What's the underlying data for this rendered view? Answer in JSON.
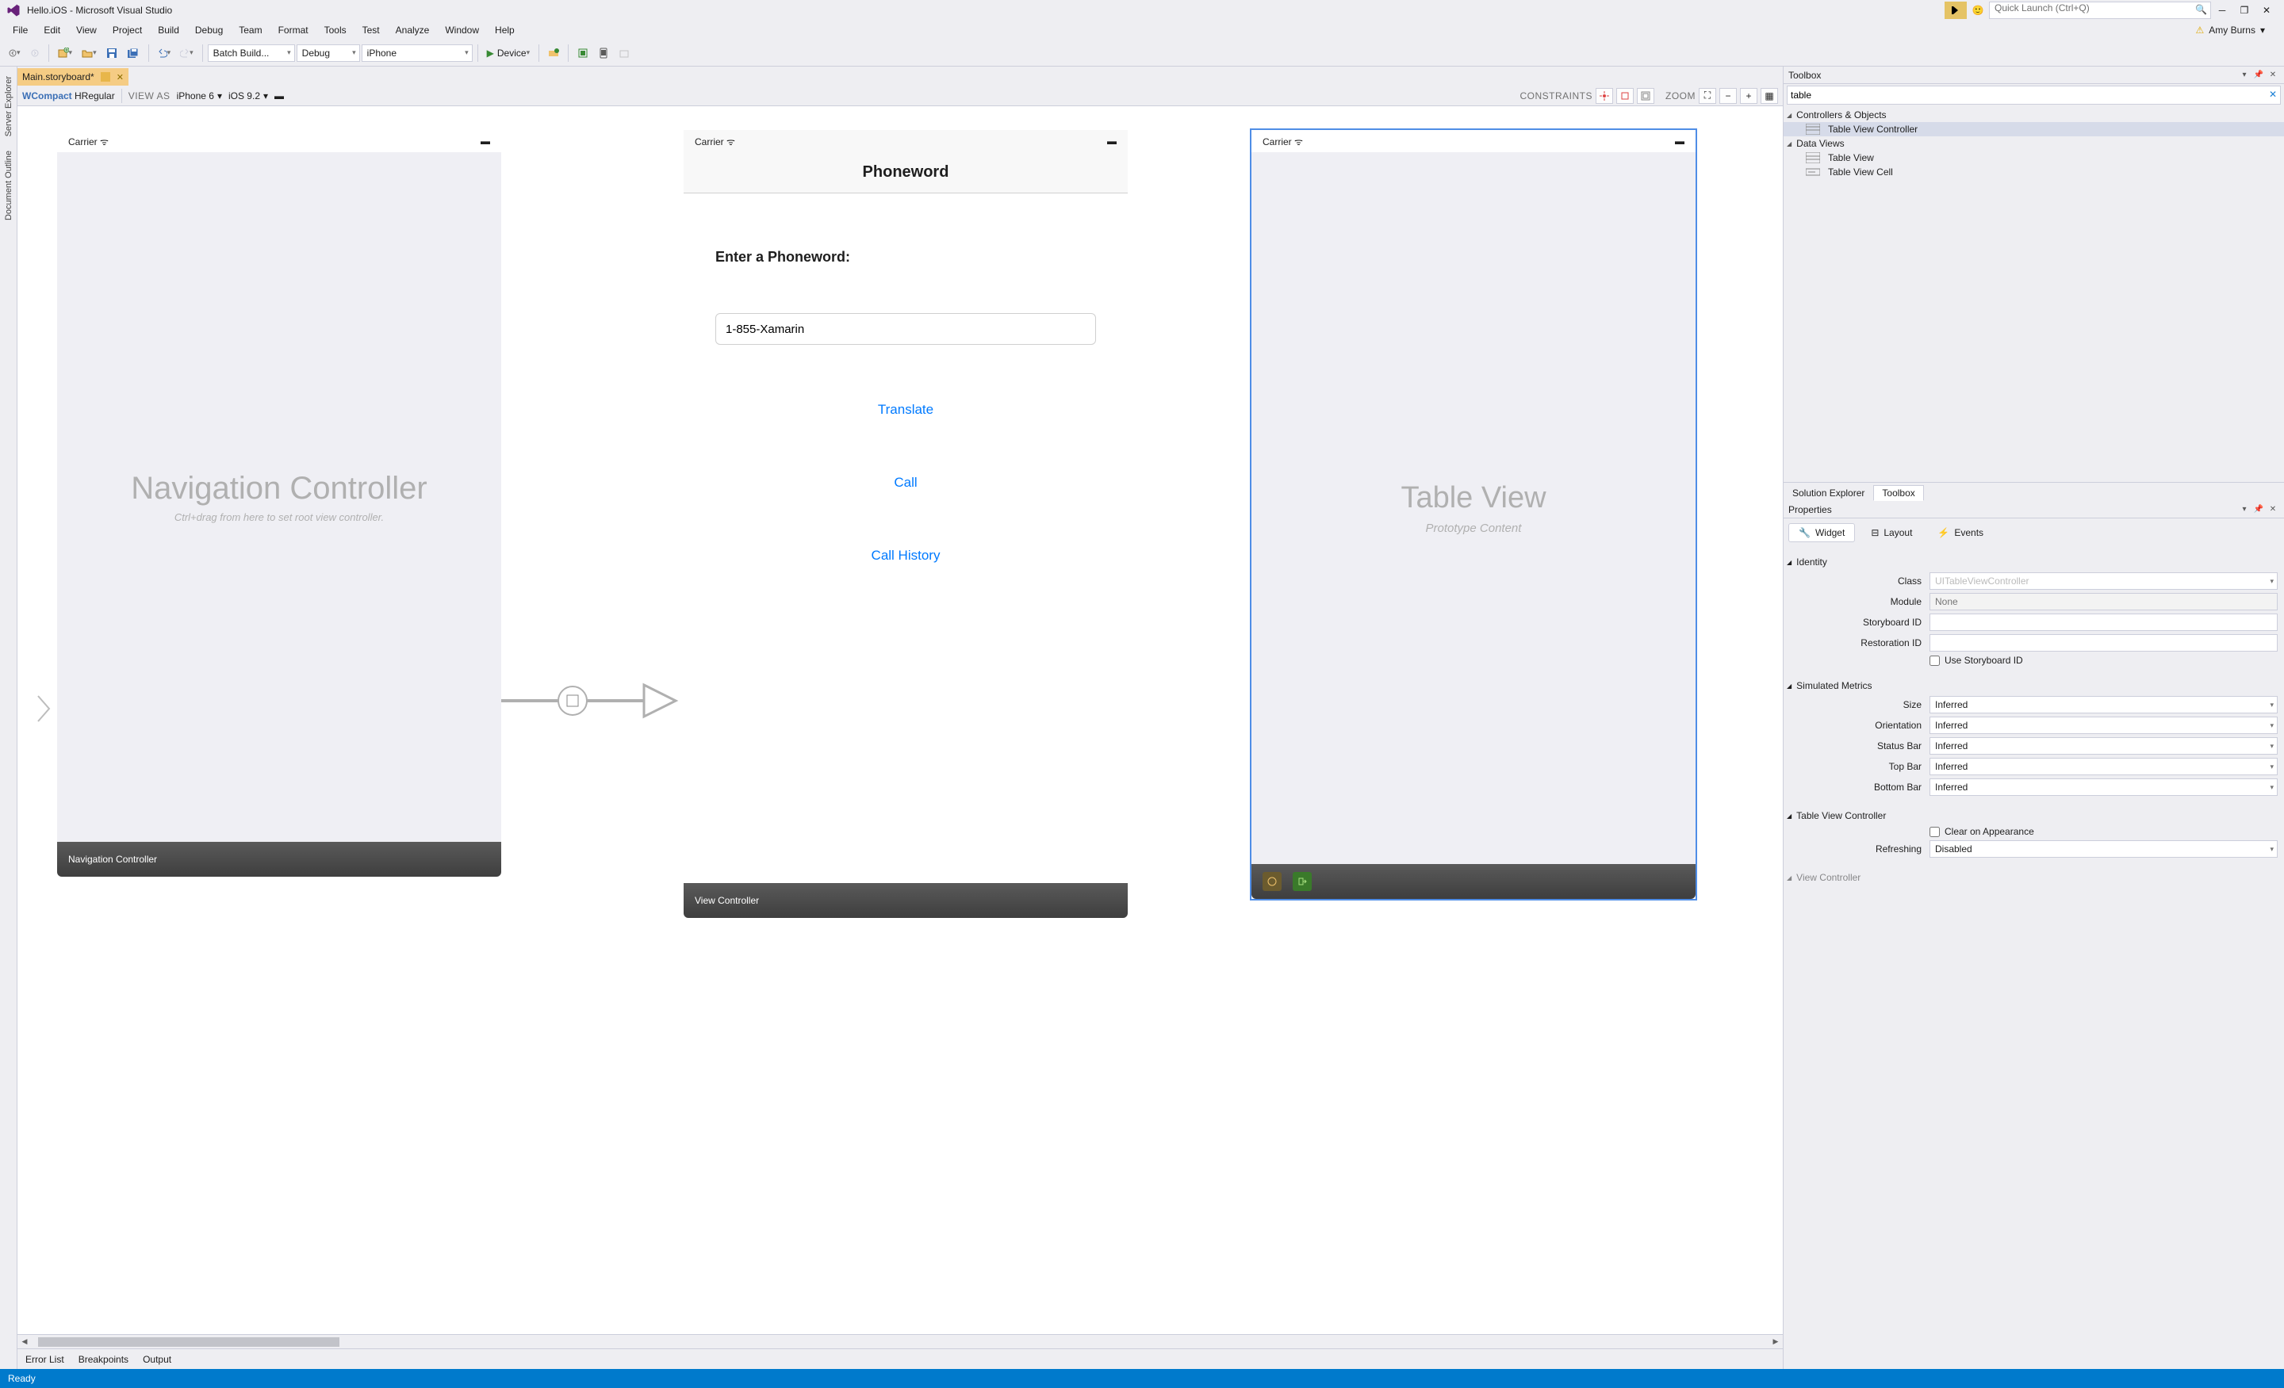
{
  "window": {
    "title": "Hello.iOS - Microsoft Visual Studio",
    "quick_launch_placeholder": "Quick Launch (Ctrl+Q)",
    "user_name": "Amy Burns"
  },
  "menu": [
    "File",
    "Edit",
    "View",
    "Project",
    "Build",
    "Debug",
    "Team",
    "Format",
    "Tools",
    "Test",
    "Analyze",
    "Window",
    "Help"
  ],
  "toolbar": {
    "batch_build": "Batch Build...",
    "config": "Debug",
    "platform": "iPhone",
    "run_label": "Device"
  },
  "doc_tab": {
    "name": "Main.storyboard*"
  },
  "designer_bar": {
    "size_class_w": "WCompact",
    "size_class_h": " HRegular",
    "view_as_label": "VIEW AS",
    "device": "iPhone 6",
    "ios": "iOS 9.2",
    "constraints_label": "CONSTRAINTS",
    "zoom_label": "ZOOM"
  },
  "canvas": {
    "nav_controller": {
      "carrier": "Carrier",
      "title": "Navigation Controller",
      "hint": "Ctrl+drag from here to set root view controller.",
      "label": "Navigation Controller"
    },
    "phoneword": {
      "carrier": "Carrier",
      "header": "Phoneword",
      "prompt": "Enter a Phoneword:",
      "input_value": "1-855-Xamarin",
      "btn_translate": "Translate",
      "btn_call": "Call",
      "btn_history": "Call History",
      "label": "View Controller"
    },
    "table_vc": {
      "carrier": "Carrier",
      "title": "Table View",
      "sub": "Prototype Content"
    }
  },
  "toolbox": {
    "panel_title": "Toolbox",
    "search_value": "table",
    "cat_controllers": "Controllers & Objects",
    "item_tvc": "Table View Controller",
    "cat_data": "Data Views",
    "item_tv": "Table View",
    "item_tvcell": "Table View Cell",
    "tab_solution": "Solution Explorer",
    "tab_toolbox": "Toolbox"
  },
  "properties": {
    "panel_title": "Properties",
    "tab_widget": "Widget",
    "tab_layout": "Layout",
    "tab_events": "Events",
    "sec_identity": "Identity",
    "lbl_class": "Class",
    "val_class": "UITableViewController",
    "lbl_module": "Module",
    "val_module": "None",
    "lbl_sbid": "Storyboard ID",
    "lbl_restid": "Restoration ID",
    "lbl_use_sbid": "Use Storyboard ID",
    "sec_sim": "Simulated Metrics",
    "lbl_size": "Size",
    "lbl_orientation": "Orientation",
    "lbl_statusbar": "Status Bar",
    "lbl_topbar": "Top Bar",
    "lbl_bottombar": "Bottom Bar",
    "val_inferred": "Inferred",
    "sec_tvc": "Table View Controller",
    "lbl_clear": "Clear on Appearance",
    "lbl_refresh": "Refreshing",
    "val_refresh": "Disabled",
    "sec_viewc": "View Controller"
  },
  "bottom_tabs": [
    "Error List",
    "Breakpoints",
    "Output"
  ],
  "status_ready": "Ready"
}
